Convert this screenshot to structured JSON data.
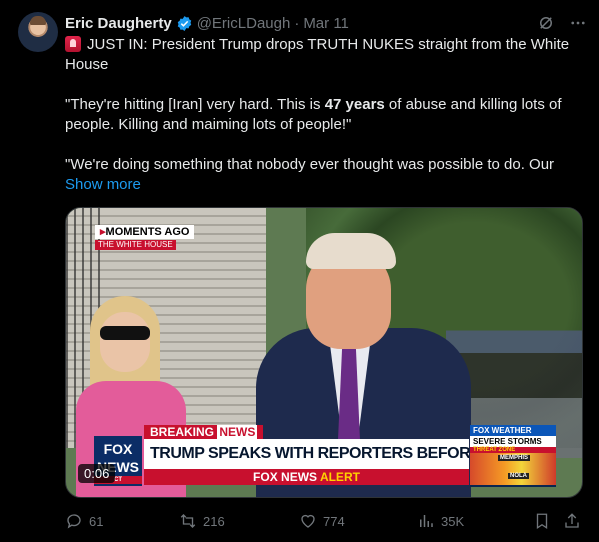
{
  "author": {
    "name": "Eric Daugherty",
    "handle": "@EricLDaugh",
    "separator": "·",
    "date": "Mar 11"
  },
  "tweet": {
    "line1": "JUST IN: President Trump drops TRUTH NUKES straight from the White House",
    "quote_pre": "\"They're hitting [Iran] very hard. This is ",
    "quote_bold": "47 years",
    "quote_post": " of abuse and killing lots of people. Killing and maiming lots of people!\"",
    "line3": "\"We're doing something that nobody ever thought was possible to do. Our",
    "show_more": "Show more"
  },
  "media": {
    "moments_label": "MOMENTS AGO",
    "location_label": "THE WHITE HOUSE",
    "breaking_prefix": "BREAKING ",
    "breaking_suffix": "NEWS",
    "chyron": "TRUMP SPEAKS WITH REPORTERS BEFORE DEPARTING WH",
    "alert_prefix": "FOX NEWS ",
    "alert_suffix": "ALERT",
    "fox_logo": "FOX NEWS",
    "fox_logo_tag": "CT",
    "weather_header": "FOX WEATHER",
    "weather_title": "SEVERE STORMS",
    "weather_zone": "THREAT ZONE",
    "weather_city1": "MEMPHIS",
    "weather_city2": "NOLA",
    "time": "0:06"
  },
  "actions": {
    "replies": "61",
    "reposts": "216",
    "likes": "774",
    "views": "35K"
  },
  "colors": {
    "background": "#000000",
    "text": "#e7e9ea",
    "muted": "#71767b",
    "accent": "#1d9bf0"
  }
}
